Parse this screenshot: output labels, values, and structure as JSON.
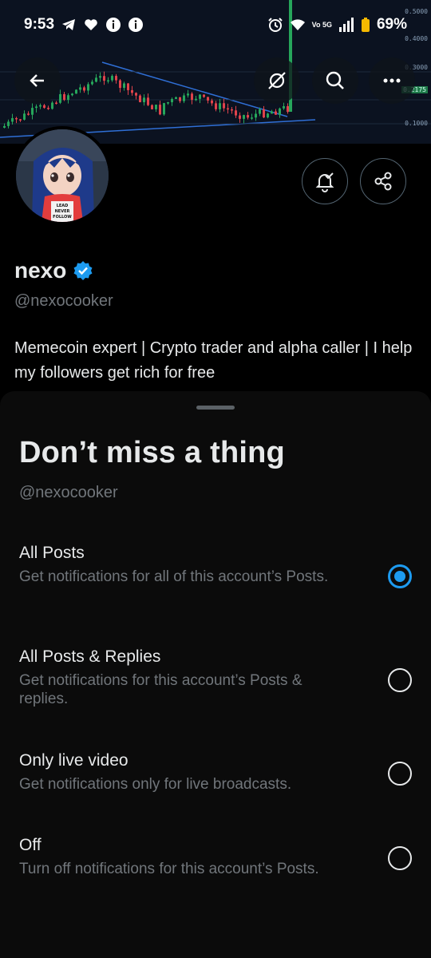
{
  "status_bar": {
    "time": "9:53",
    "battery": "69%",
    "network_label": "Vo 5G"
  },
  "banner": {
    "tick_labels": [
      "0.5000",
      "0.4000",
      "0.3000",
      "0.2175",
      "0.1000"
    ],
    "buttons": [
      "back-arrow-icon",
      "no-sync-icon",
      "search-icon",
      "more-icon"
    ]
  },
  "profile": {
    "display_name": "nexo",
    "handle": "@nexocooker",
    "bio": "Memecoin expert | Crypto trader and alpha caller | I help my followers get rich for free",
    "verified": true,
    "avatar_shirt_text": "LEAD NEVER FOLLOW"
  },
  "sheet": {
    "title": "Don’t miss a thing",
    "handle": "@nexocooker",
    "options": [
      {
        "title": "All Posts",
        "desc": "Get notifications for all of this account’s Posts.",
        "selected": true
      },
      {
        "title": "All Posts & Replies",
        "desc": "Get notifications for this account’s Posts & replies.",
        "selected": false
      },
      {
        "title": "Only live video",
        "desc": "Get notifications only for live broadcasts.",
        "selected": false
      },
      {
        "title": "Off",
        "desc": "Turn off notifications for this account’s Posts.",
        "selected": false
      }
    ]
  },
  "colors": {
    "accent": "#1d9bf0",
    "secondary_text": "#71767b",
    "primary_text": "#e7e9ea"
  }
}
